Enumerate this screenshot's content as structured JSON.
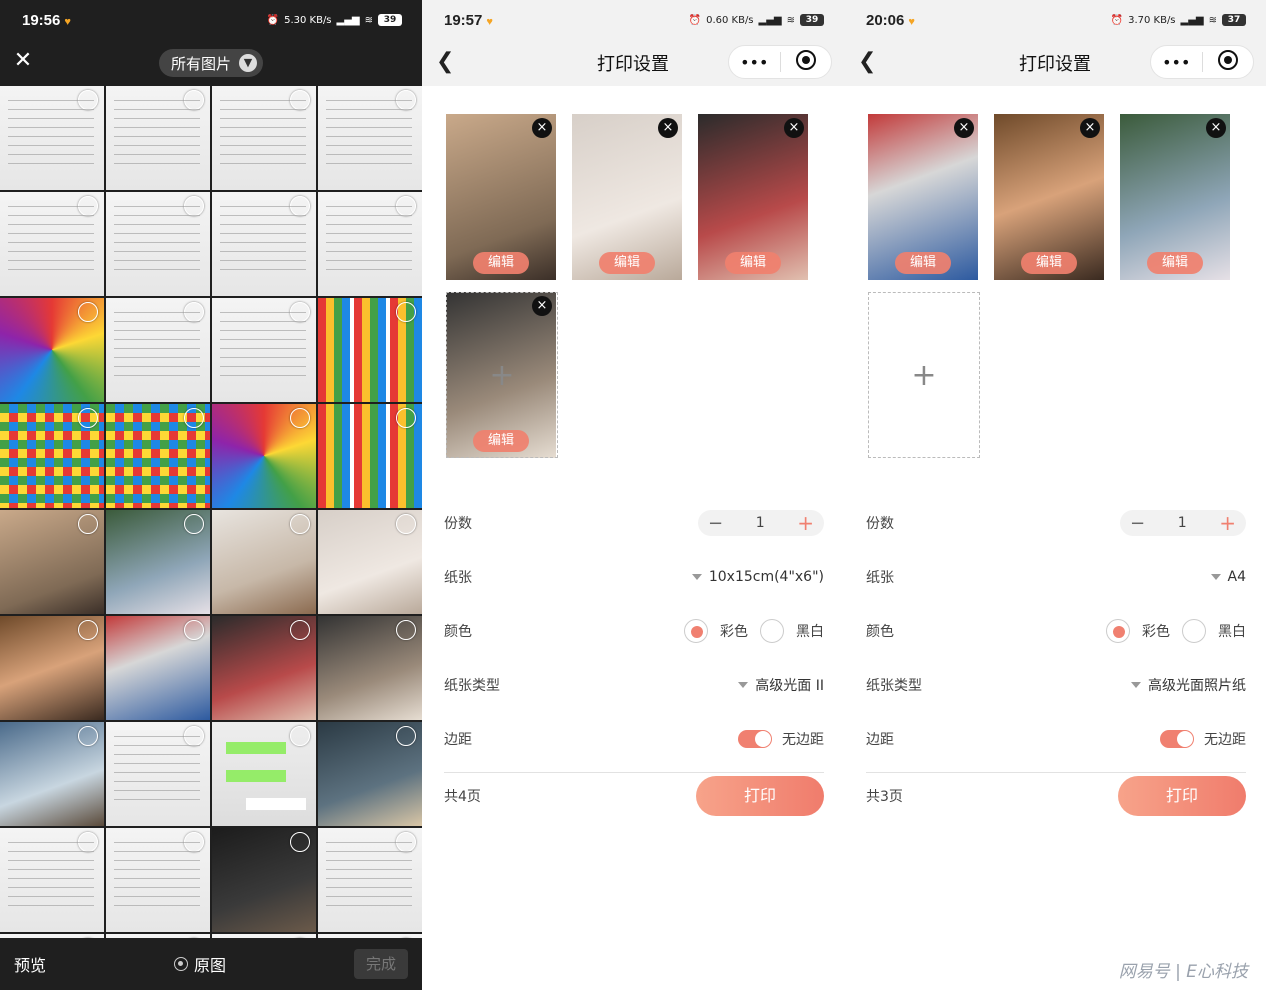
{
  "picker": {
    "status": {
      "time": "19:56",
      "speed": "5.30 KB/s",
      "battery": "39"
    },
    "album_label": "所有图片",
    "preview_label": "预览",
    "original_label": "原图",
    "done_label": "完成",
    "thumbnails": [
      "doc",
      "doc",
      "doc",
      "doc",
      "doc",
      "doc",
      "doc",
      "doc",
      "swatch",
      "doc",
      "doc",
      "bars",
      "swatch2",
      "swatch2",
      "swatch",
      "bars",
      "photo1",
      "photo2",
      "photo3",
      "photo4",
      "photo5",
      "photo6",
      "photo7",
      "photo8",
      "photo9",
      "doc",
      "green",
      "photo11",
      "doc",
      "doc",
      "photo12",
      "doc",
      "doc",
      "doc",
      "doc",
      "doc"
    ]
  },
  "screen2": {
    "status": {
      "time": "19:57",
      "speed": "0.60 KB/s",
      "battery": "39"
    },
    "title": "打印设置",
    "capsule_more": "•••",
    "photos": [
      "photo1",
      "photo4",
      "photo7",
      "photo8"
    ],
    "edit_label": "编辑",
    "remove_label": "×",
    "add_label": "+",
    "copies_label": "份数",
    "copies_value": "1",
    "minus": "−",
    "plus": "+",
    "paper_label": "纸张",
    "paper_value": "10x15cm(4\"x6\")",
    "color_label": "颜色",
    "color_option": "彩色",
    "bw_option": "黑白",
    "paper_type_label": "纸张类型",
    "paper_type_value": "高级光面 II",
    "margin_label": "边距",
    "margin_value": "无边距",
    "pages_label": "共4页",
    "print_label": "打印"
  },
  "screen3": {
    "status": {
      "time": "20:06",
      "speed": "3.70 KB/s",
      "battery": "37"
    },
    "title": "打印设置",
    "capsule_more": "•••",
    "photos": [
      "photo6",
      "photo5",
      "photo2"
    ],
    "edit_label": "编辑",
    "remove_label": "×",
    "add_label": "+",
    "copies_label": "份数",
    "copies_value": "1",
    "minus": "−",
    "plus": "+",
    "paper_label": "纸张",
    "paper_value": "A4",
    "color_label": "颜色",
    "color_option": "彩色",
    "bw_option": "黑白",
    "paper_type_label": "纸张类型",
    "paper_type_value": "高级光面照片纸",
    "margin_label": "边距",
    "margin_value": "无边距",
    "pages_label": "共3页",
    "print_label": "打印"
  },
  "watermark": "网易号 | E心科技",
  "colors": {
    "accent": "#f08070",
    "picker_bg": "#1f1f1f"
  }
}
